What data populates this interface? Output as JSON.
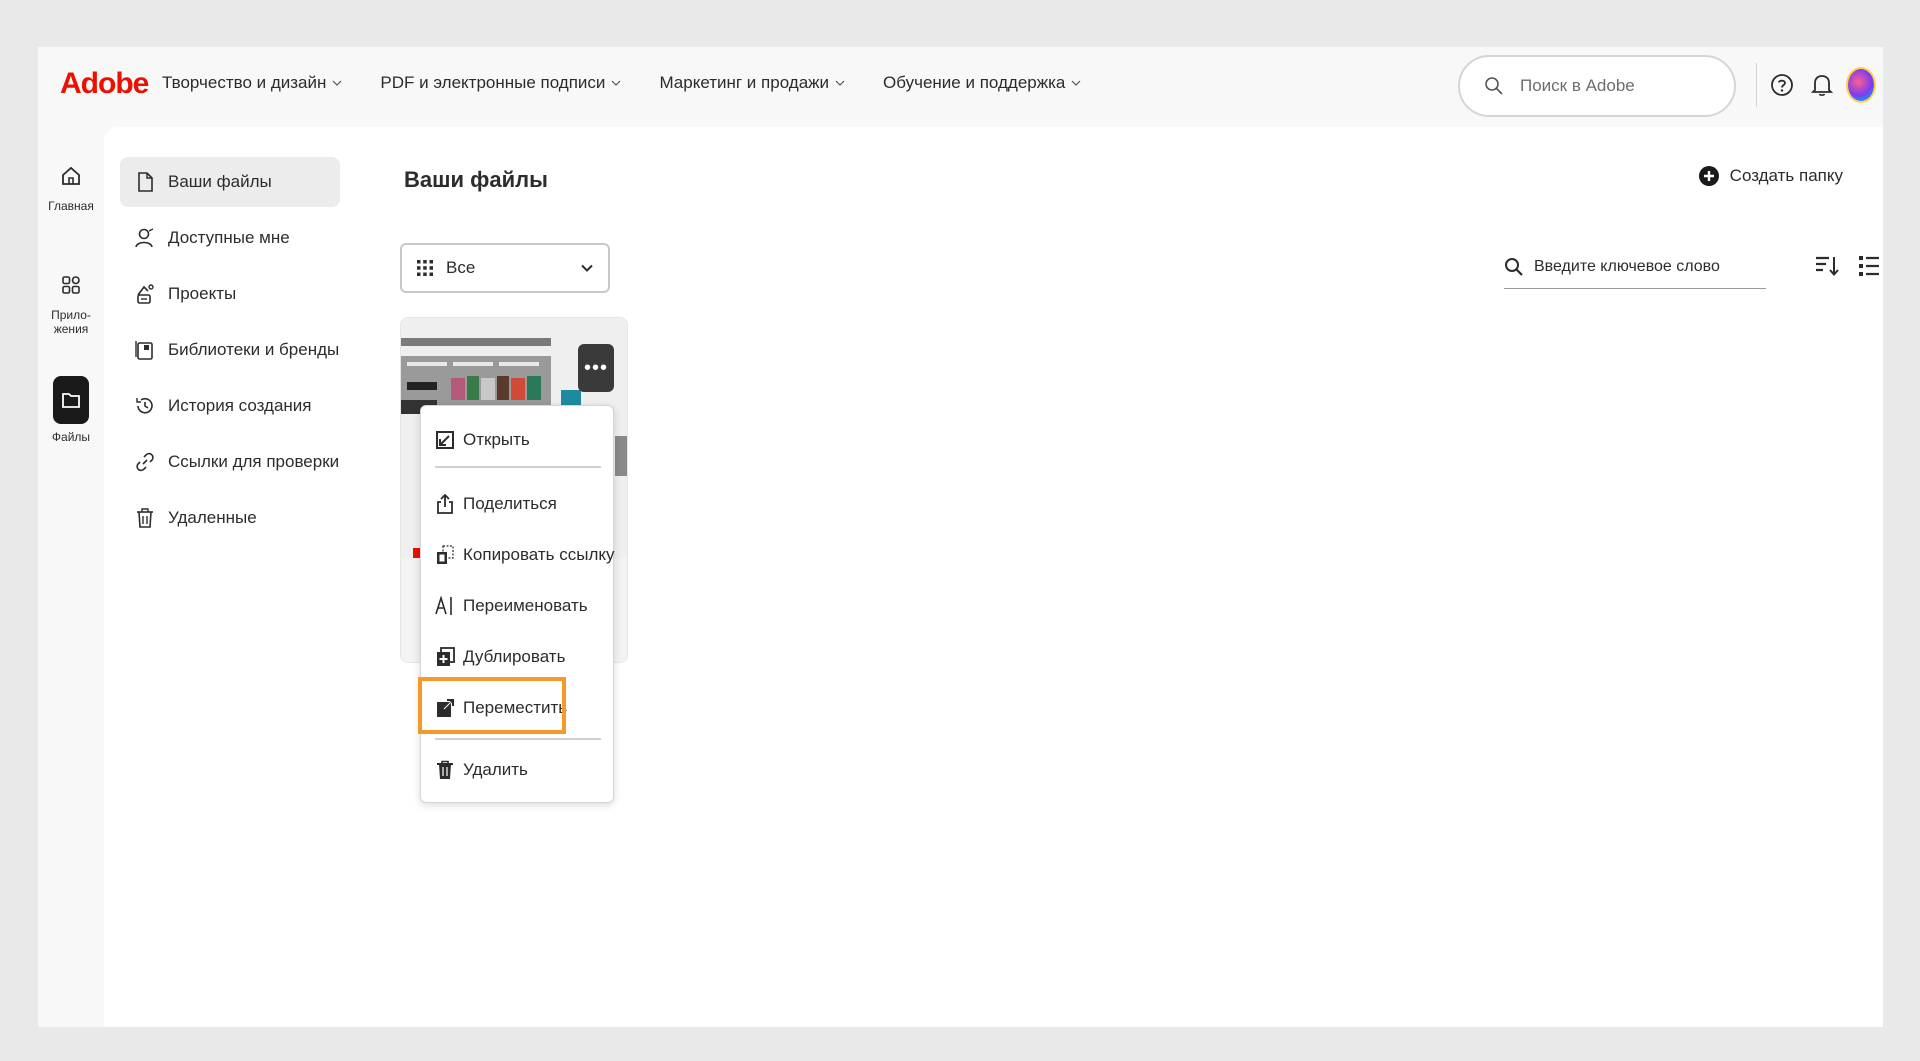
{
  "brand": {
    "logo_text": "Adobe",
    "logo_color": "#eb1000"
  },
  "topnav": {
    "items": [
      {
        "label": "Творчество и дизайн"
      },
      {
        "label": "PDF и электронные подписи"
      },
      {
        "label": "Маркетинг и продажи"
      },
      {
        "label": "Обучение и поддержка"
      }
    ],
    "search_placeholder": "Поиск в Adobe"
  },
  "rail": {
    "items": [
      {
        "label": "Главная",
        "icon": "home-icon"
      },
      {
        "label": "Прило-жения",
        "icon": "apps-icon"
      },
      {
        "label": "Файлы",
        "icon": "files-icon",
        "active": true
      }
    ]
  },
  "sidenav": {
    "items": [
      {
        "label": "Ваши файлы",
        "icon": "file-icon",
        "active": true
      },
      {
        "label": "Доступные мне",
        "icon": "shared-user-icon"
      },
      {
        "label": "Проекты",
        "icon": "projects-icon"
      },
      {
        "label": "Библиотеки и бренды",
        "icon": "library-icon"
      },
      {
        "label": "История создания",
        "icon": "history-icon"
      },
      {
        "label": "Ссылки для проверки",
        "icon": "link-icon"
      },
      {
        "label": "Удаленные",
        "icon": "trash-icon"
      }
    ]
  },
  "main": {
    "title": "Ваши файлы",
    "create_folder_label": "Создать папку",
    "filter_value": "Все",
    "keyword_search_placeholder": "Введите ключевое слово"
  },
  "context_menu": {
    "items": [
      {
        "label": "Открыть",
        "icon": "open-icon"
      },
      {
        "label": "Поделиться",
        "icon": "share-icon"
      },
      {
        "label": "Копировать ссылку",
        "icon": "copy-link-icon"
      },
      {
        "label": "Переименовать",
        "icon": "rename-icon"
      },
      {
        "label": "Дублировать",
        "icon": "duplicate-icon"
      },
      {
        "label": "Переместить",
        "icon": "move-icon",
        "highlighted": true
      },
      {
        "label": "Удалить",
        "icon": "delete-icon"
      }
    ],
    "highlight_color": "#f39a28"
  }
}
